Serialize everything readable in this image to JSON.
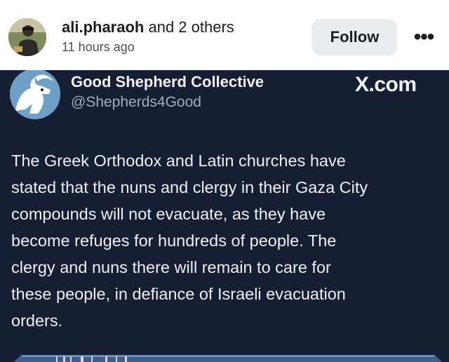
{
  "post": {
    "author_primary": "ali.pharaoh",
    "author_suffix": " and 2 others",
    "timestamp": "11 hours ago",
    "follow_label": "Follow",
    "more_label": "•••"
  },
  "card": {
    "account_name": "Good Shepherd Collective",
    "handle": "@Shepherds4Good",
    "source": "X.com",
    "body_lines": [
      "The Greek Orthodox and Latin churches have",
      "stated that the nuns and clergy in their Gaza City",
      "compounds will not evacuate, as they have",
      "become refuges for hundreds of people. The",
      "clergy and nuns there will remain to care for",
      "these people, in defiance of Israeli evacuation",
      "orders."
    ]
  },
  "colors": {
    "card_background": "#151e33",
    "follow_button": "#e9ecf0",
    "text_primary": "#1c1e21"
  },
  "icons": {
    "more": "more-horizontal-icon",
    "user_avatar": "profile-photo-avatar",
    "collective_logo": "goat-logo-icon"
  }
}
